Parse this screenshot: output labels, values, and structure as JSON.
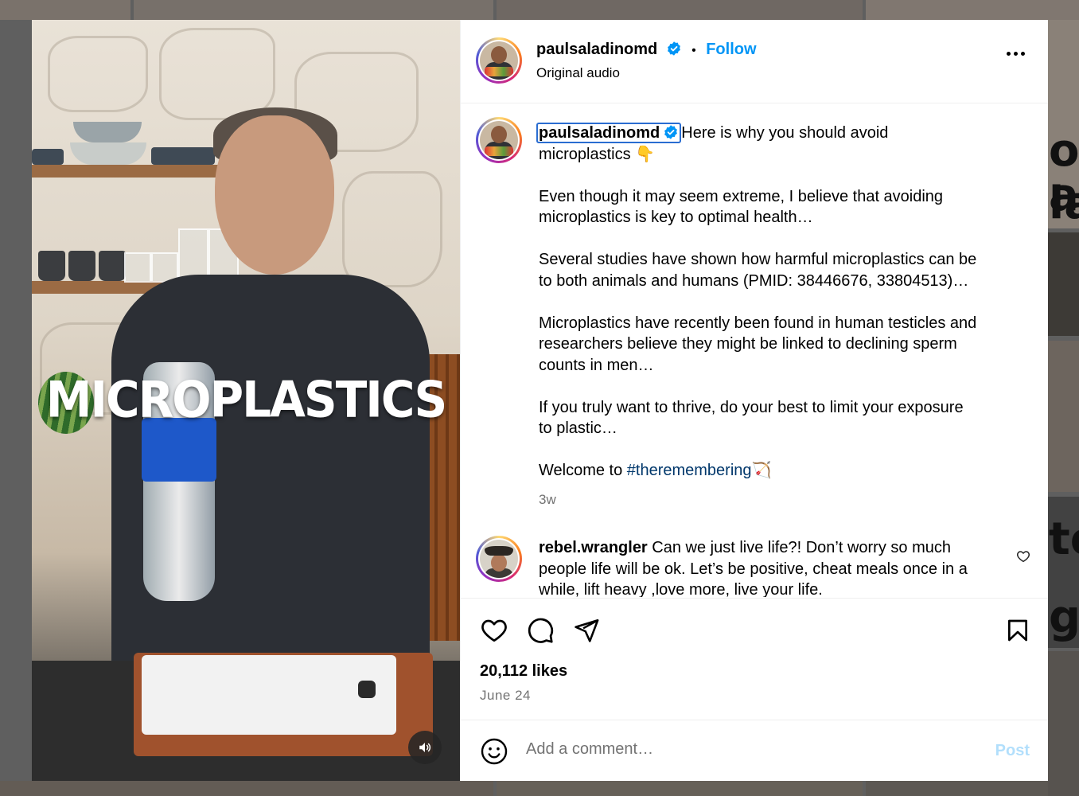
{
  "post": {
    "username": "paulsaladinomd",
    "follow_label": "Follow",
    "separator": "•",
    "audio_label": "Original audio",
    "video_overlay_text": "MICROPLASTICS",
    "caption": {
      "username": "paulsaladinomd",
      "line1": "Here is why you should avoid\nmicroplastics 👇",
      "para2": "Even though it may seem extreme, I believe that avoiding\nmicroplastics is key to optimal health…",
      "para3": "Several studies have shown how harmful microplastics can be\nto both animals and humans (PMID: 38446676, 33804513)…",
      "para4": "Microplastics have recently been found in human testicles and\nresearchers believe they might be linked to declining sperm\ncounts in men…",
      "para5": "If you truly want to thrive, do your best to limit your exposure\nto plastic…",
      "welcome": "Welcome to ",
      "hashtag": "#theremembering",
      "welcome_emoji": "🏹",
      "time_ago": "3w"
    },
    "comments": [
      {
        "username": "rebel.wrangler",
        "text": " Can we just live life?! Don’t worry so much people life will be ok. Let’s be positive, cheat meals once in a while, lift heavy ,love more, live your life."
      }
    ],
    "likes_text": "20,112 likes",
    "date_text": "June 24"
  },
  "comment_box": {
    "placeholder": "Add a comment…",
    "post_label": "Post"
  },
  "background": {
    "right_fragments": [
      "o a",
      "la",
      "to",
      "gg"
    ]
  },
  "icons": {
    "verified": "verified-badge-icon",
    "more": "more-options-icon",
    "like": "heart-icon",
    "comment": "comment-bubble-icon",
    "share": "paper-plane-icon",
    "save": "bookmark-icon",
    "emoji": "smiley-icon",
    "sound": "speaker-icon"
  },
  "colors": {
    "accent": "#0095f6",
    "hashtag": "#00376b",
    "muted": "#737373",
    "post_disabled": "#b2dffc"
  }
}
